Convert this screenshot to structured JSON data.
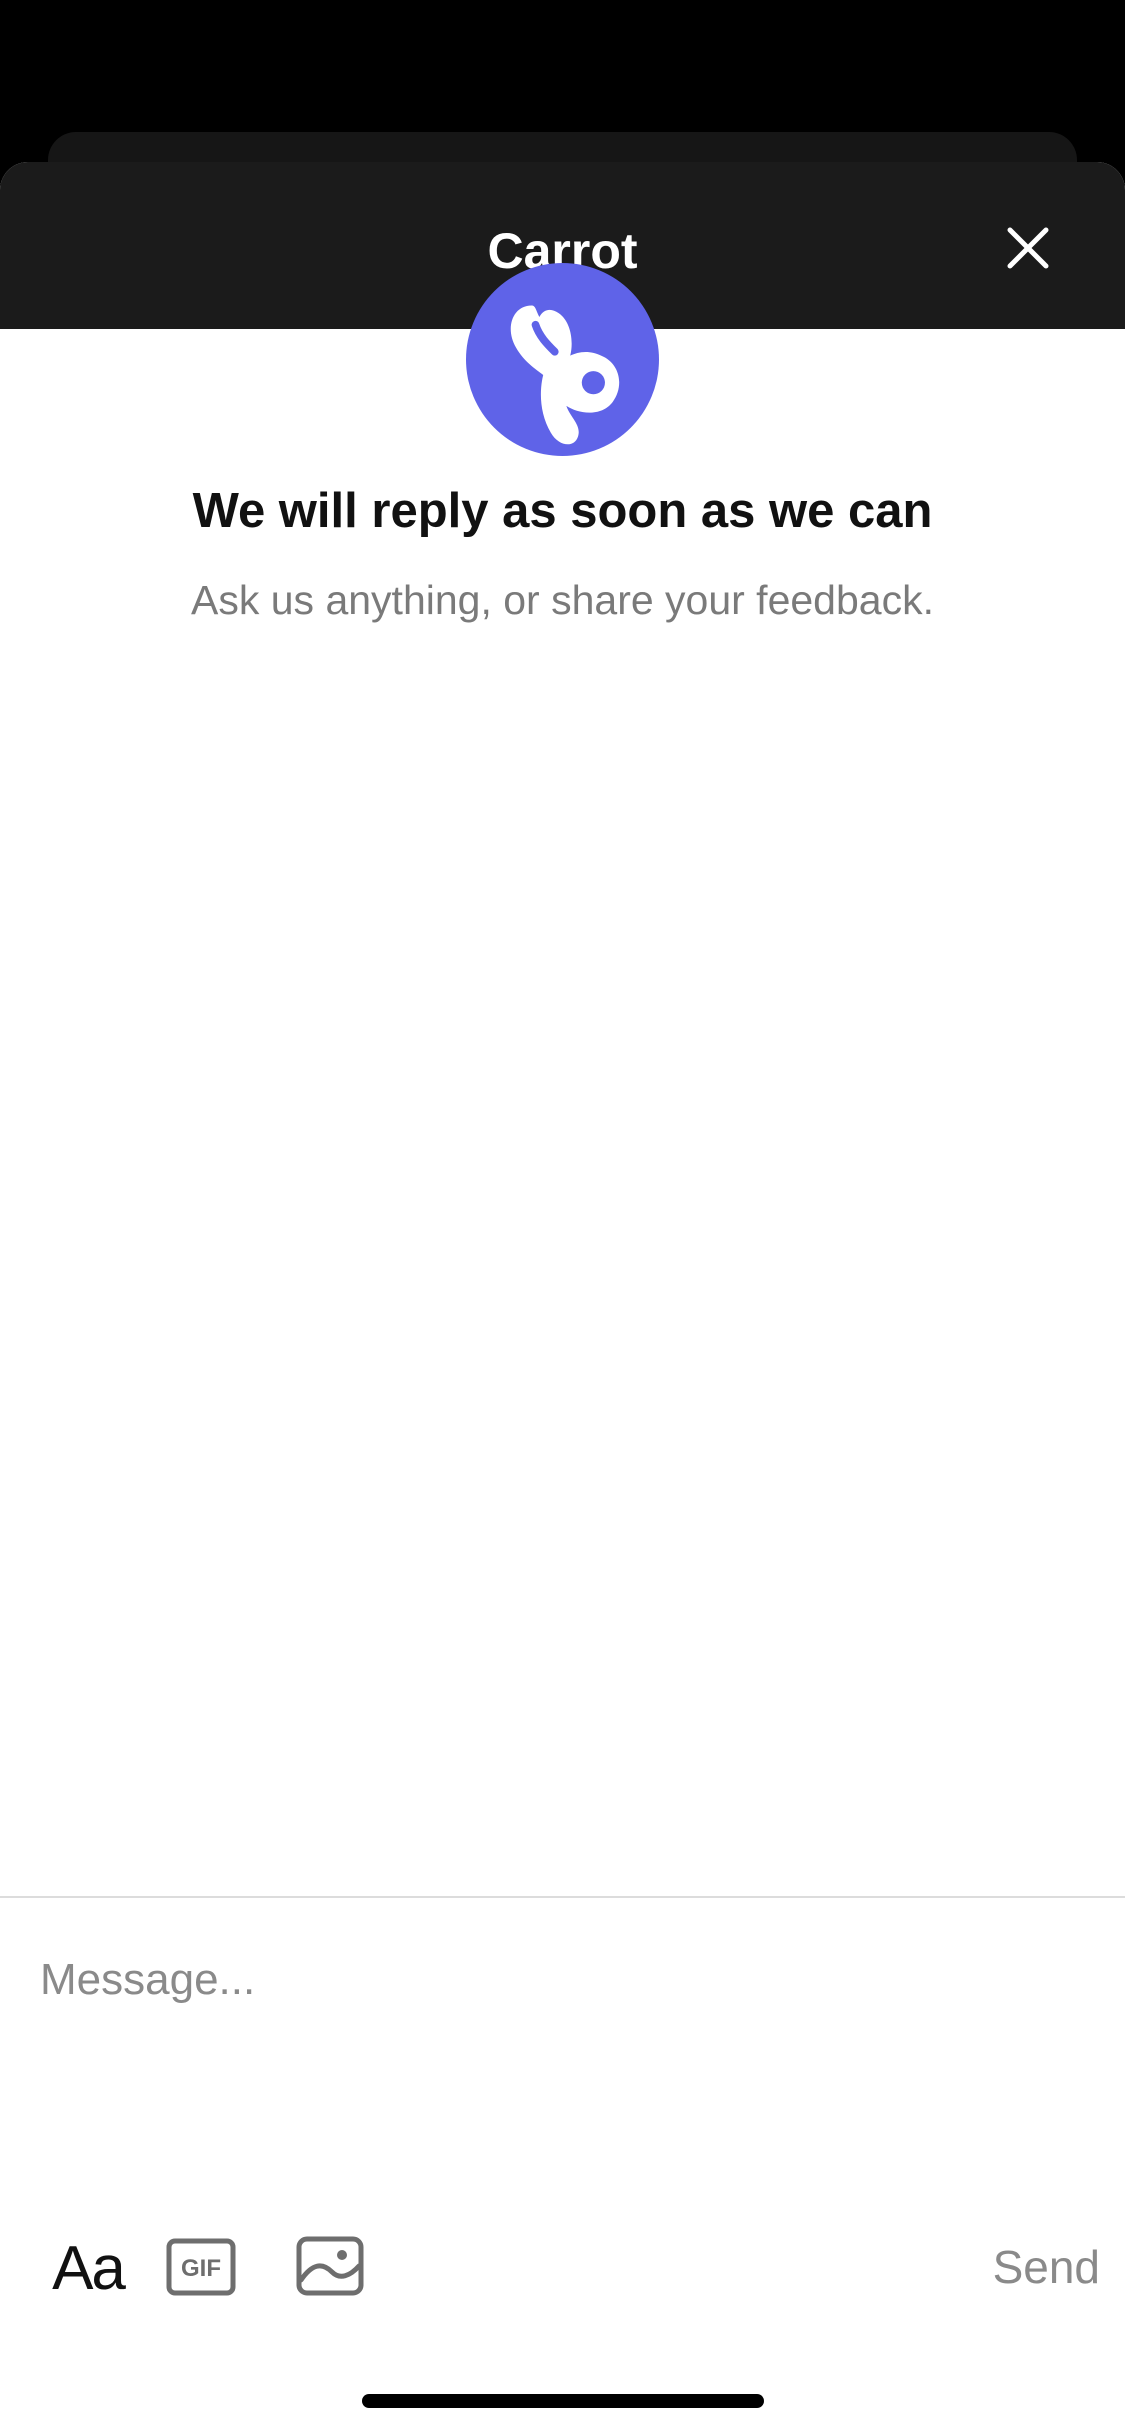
{
  "header": {
    "title": "Carrot",
    "close_icon": "close-icon"
  },
  "welcome": {
    "logo_icon": "carrot-logo-icon",
    "logo_color": "#5f63e8",
    "headline": "We will reply as soon as we can",
    "subline": "Ask us anything, or share your feedback."
  },
  "composer": {
    "placeholder": "Message...",
    "value": "",
    "format_label": "Aa",
    "gif_label": "GIF",
    "gif_icon": "gif-icon",
    "image_icon": "image-icon",
    "send_label": "Send"
  },
  "colors": {
    "header_bg": "#1b1b1b",
    "accent": "#5f63e8",
    "muted_text": "#7a7a7a"
  }
}
